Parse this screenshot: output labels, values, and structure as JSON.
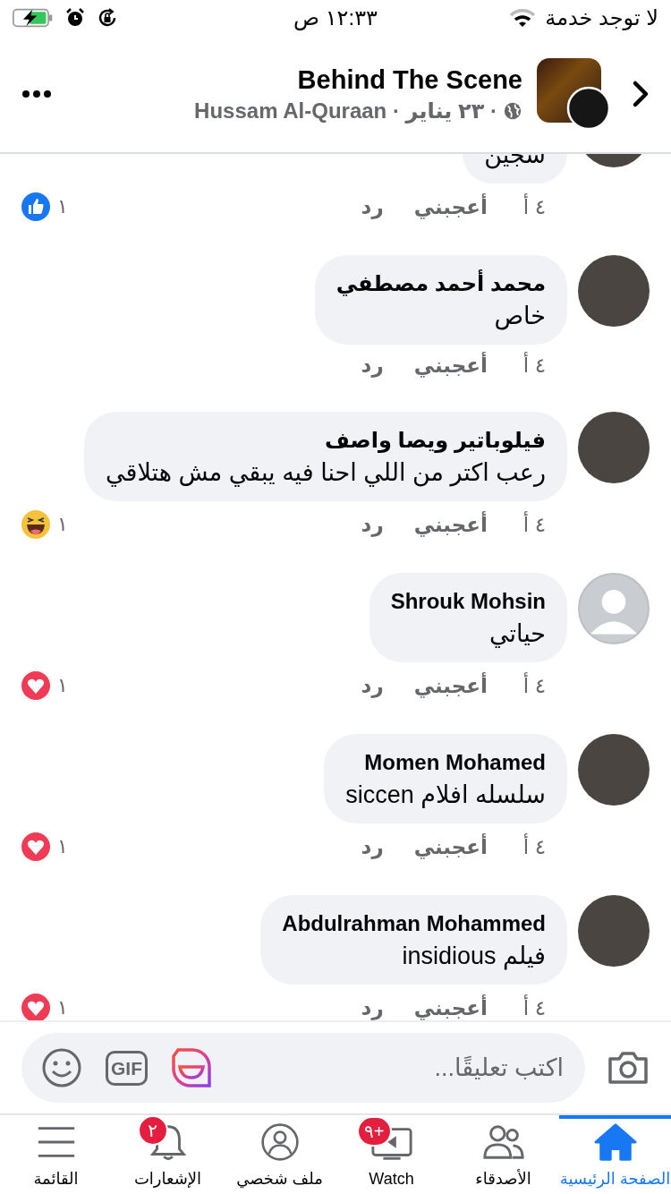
{
  "status_bar": {
    "carrier": "لا توجد خدمة",
    "time": "١٢:٣٣ ص"
  },
  "header": {
    "title": "Behind The Scene",
    "subtitle": "· ٢٣ يناير · Hussam Al-Quraan"
  },
  "comments": [
    {
      "kind": "cut",
      "body": "سجين",
      "time": "٤ أ",
      "like": "أعجبني",
      "reply": "رد",
      "reaction": {
        "kind": "like",
        "count": "١"
      }
    },
    {
      "kind": "full",
      "name": "محمد أحمد مصطفي",
      "body": "خاص",
      "time": "٤ أ",
      "like": "أعجبني",
      "reply": "رد"
    },
    {
      "kind": "full",
      "name": "فيلوباتير ويصا واصف",
      "body": "رعب اكتر من اللي احنا فيه يبقي مش هتلاقي",
      "time": "٤ أ",
      "like": "أعجبني",
      "reply": "رد",
      "reaction": {
        "kind": "haha",
        "count": "١"
      }
    },
    {
      "kind": "full",
      "name": "Shrouk Mohsin",
      "body": "حياتي",
      "time": "٤ أ",
      "like": "أعجبني",
      "reply": "رد",
      "default_avatar": true,
      "reaction": {
        "kind": "love",
        "count": "١"
      }
    },
    {
      "kind": "full",
      "name": "Momen Mohamed",
      "body": "سلسله افلام siccen",
      "time": "٤ أ",
      "like": "أعجبني",
      "reply": "رد",
      "reaction": {
        "kind": "love",
        "count": "١"
      }
    },
    {
      "kind": "full",
      "name": "Abdulrahman Mohammed",
      "body": "فيلم insidious",
      "time": "٤ أ",
      "like": "أعجبني",
      "reply": "رد",
      "reaction": {
        "kind": "love",
        "count": "١"
      }
    }
  ],
  "composer": {
    "placeholder": "اكتب تعليقًا...",
    "gif_label": "GIF"
  },
  "tabs": [
    {
      "kind": "home",
      "label": "الصفحة الرئيسية",
      "selected": true
    },
    {
      "kind": "friends",
      "label": "الأصدقاء",
      "selected": false
    },
    {
      "kind": "watch",
      "label": "Watch",
      "selected": false,
      "badge": "٩+"
    },
    {
      "kind": "profile",
      "label": "ملف شخصي",
      "selected": false
    },
    {
      "kind": "bell",
      "label": "الإشعارات",
      "selected": false,
      "badge": "٢"
    },
    {
      "kind": "menu",
      "label": "القائمة",
      "selected": false
    }
  ]
}
